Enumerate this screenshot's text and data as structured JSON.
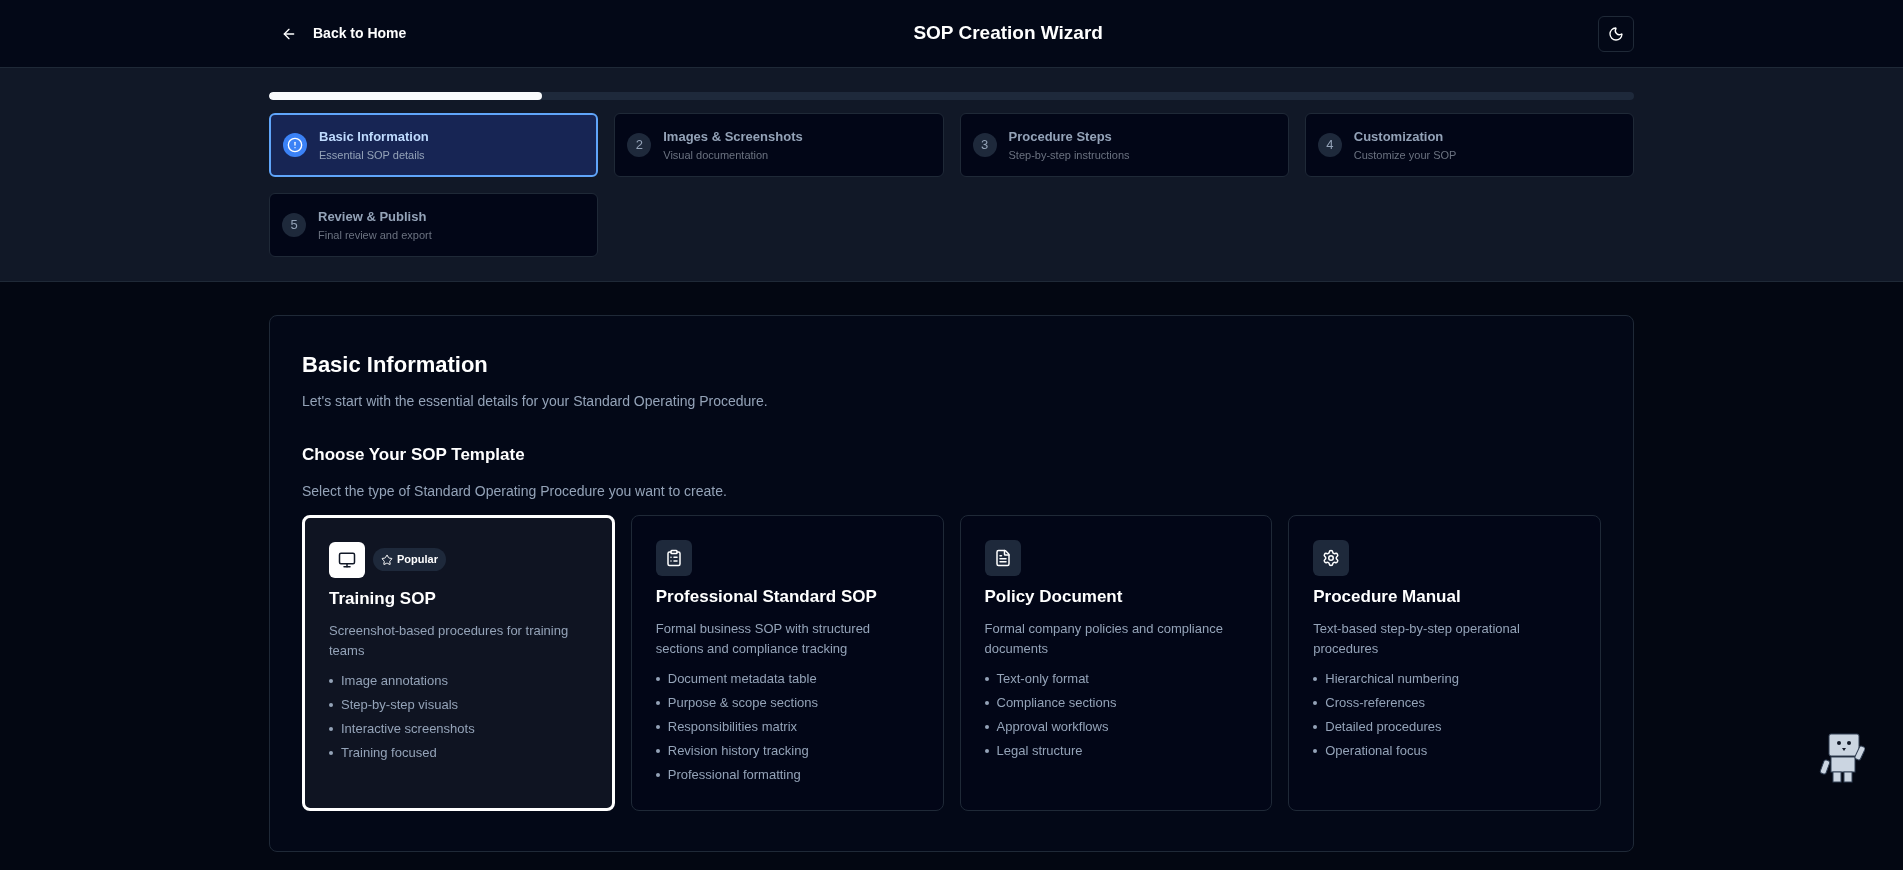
{
  "header": {
    "back_link": "Back to Home",
    "title": "SOP Creation Wizard"
  },
  "progress": {
    "level": 0.2
  },
  "steps": [
    {
      "title": "Basic Information",
      "subtitle": "Essential SOP details",
      "selected": true
    },
    {
      "number": "2",
      "title": "Images & Screenshots",
      "subtitle": "Visual documentation",
      "selected": false
    },
    {
      "number": "3",
      "title": "Procedure Steps",
      "subtitle": "Step-by-step instructions",
      "selected": false
    },
    {
      "number": "4",
      "title": "Customization",
      "subtitle": "Customize your SOP",
      "selected": false
    },
    {
      "number": "5",
      "title": "Review & Publish",
      "subtitle": "Final review and export",
      "selected": false
    }
  ],
  "section": {
    "title": "Basic Information",
    "description": "Let's start with the essential details for your Standard Operating Procedure.",
    "subheading": "Choose Your SOP Template",
    "subdescription": "Select the type of Standard Operating Procedure you want to create."
  },
  "templates": [
    {
      "badge": "Popular",
      "title": "Training SOP",
      "description": "Screenshot-based procedures for training teams",
      "features": [
        "Image annotations",
        "Step-by-step visuals",
        "Interactive screenshots",
        "Training focused"
      ],
      "selected": true
    },
    {
      "title": "Professional Standard SOP",
      "description": "Formal business SOP with structured sections and compliance tracking",
      "features": [
        "Document metadata table",
        "Purpose & scope sections",
        "Responsibilities matrix",
        "Revision history tracking",
        "Professional formatting"
      ],
      "selected": false
    },
    {
      "title": "Policy Document",
      "description": "Formal company policies and compliance documents",
      "features": [
        "Text-only format",
        "Compliance sections",
        "Approval workflows",
        "Legal structure"
      ],
      "selected": false
    },
    {
      "title": "Procedure Manual",
      "description": "Text-based step-by-step operational procedures",
      "features": [
        "Hierarchical numbering",
        "Cross-references",
        "Detailed procedures",
        "Operational focus"
      ],
      "selected": false
    }
  ]
}
